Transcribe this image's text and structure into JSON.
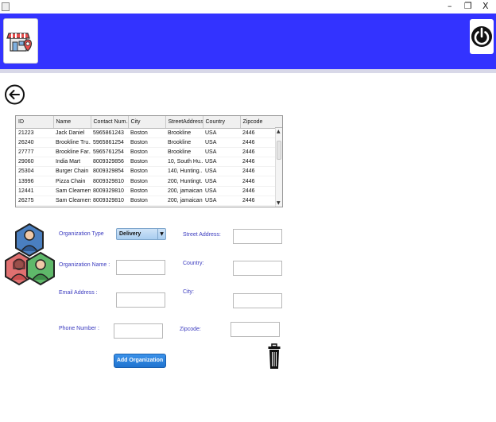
{
  "window": {
    "minimize_glyph": "–",
    "restore_glyph": "❐",
    "close_glyph": "X"
  },
  "header": {
    "bar_color": "#3333ff",
    "left_icon": "store-location-icon",
    "right_icon": "power-icon"
  },
  "nav": {
    "back_icon": "back-arrow-icon"
  },
  "table": {
    "columns": [
      "ID",
      "Name",
      "Contact Num...",
      "City",
      "StreetAddress",
      "Country",
      "Zipcode"
    ],
    "rows": [
      [
        "21223",
        "Jack Daniel",
        "5965861243",
        "Boston",
        "Brookline",
        "USA",
        "2446"
      ],
      [
        "26240",
        "Brookline Tru...",
        "5965861254",
        "Boston",
        "Brookline",
        "USA",
        "2446"
      ],
      [
        "27777",
        "Brookline Far...",
        "5965761254",
        "Boston",
        "Brookline",
        "USA",
        "2446"
      ],
      [
        "29060",
        "India Mart",
        "8009329856",
        "Boston",
        "10, South Hu...",
        "USA",
        "2446"
      ],
      [
        "25304",
        "Burger Chain",
        "8009329854",
        "Boston",
        "140,  Hunting...",
        "USA",
        "2446"
      ],
      [
        "13996",
        "Pizza Chain",
        "8009329810",
        "Boston",
        "200,  Huntingt...",
        "USA",
        "2446"
      ],
      [
        "12441",
        "Sam Cleamers",
        "8009329810",
        "Boston",
        "200, jamaican...",
        "USA",
        "2446"
      ],
      [
        "26275",
        "Sam Cleamers",
        "8009329810",
        "Boston",
        "200, jamaican...",
        "USA",
        "2446"
      ]
    ]
  },
  "form": {
    "illustration_icon": "organization-people-icon",
    "org_type_label": "Organization Type",
    "org_type_value": "Delivery",
    "org_name_label": "Organization Name :",
    "email_label": "Email Address :",
    "phone_label": "Phone Number :",
    "street_label": "Street Address:",
    "country_label": "Country:",
    "city_label": "City:",
    "zipcode_label": "Zipcode:",
    "org_name_value": "",
    "email_value": "",
    "phone_value": "",
    "street_value": "",
    "country_value": "",
    "city_value": "",
    "zipcode_value": "",
    "add_button_label": "Add Organization",
    "delete_icon": "trash-icon"
  },
  "colors": {
    "label_blue": "#3b3bbf",
    "button_blue": "#2a82dc"
  }
}
